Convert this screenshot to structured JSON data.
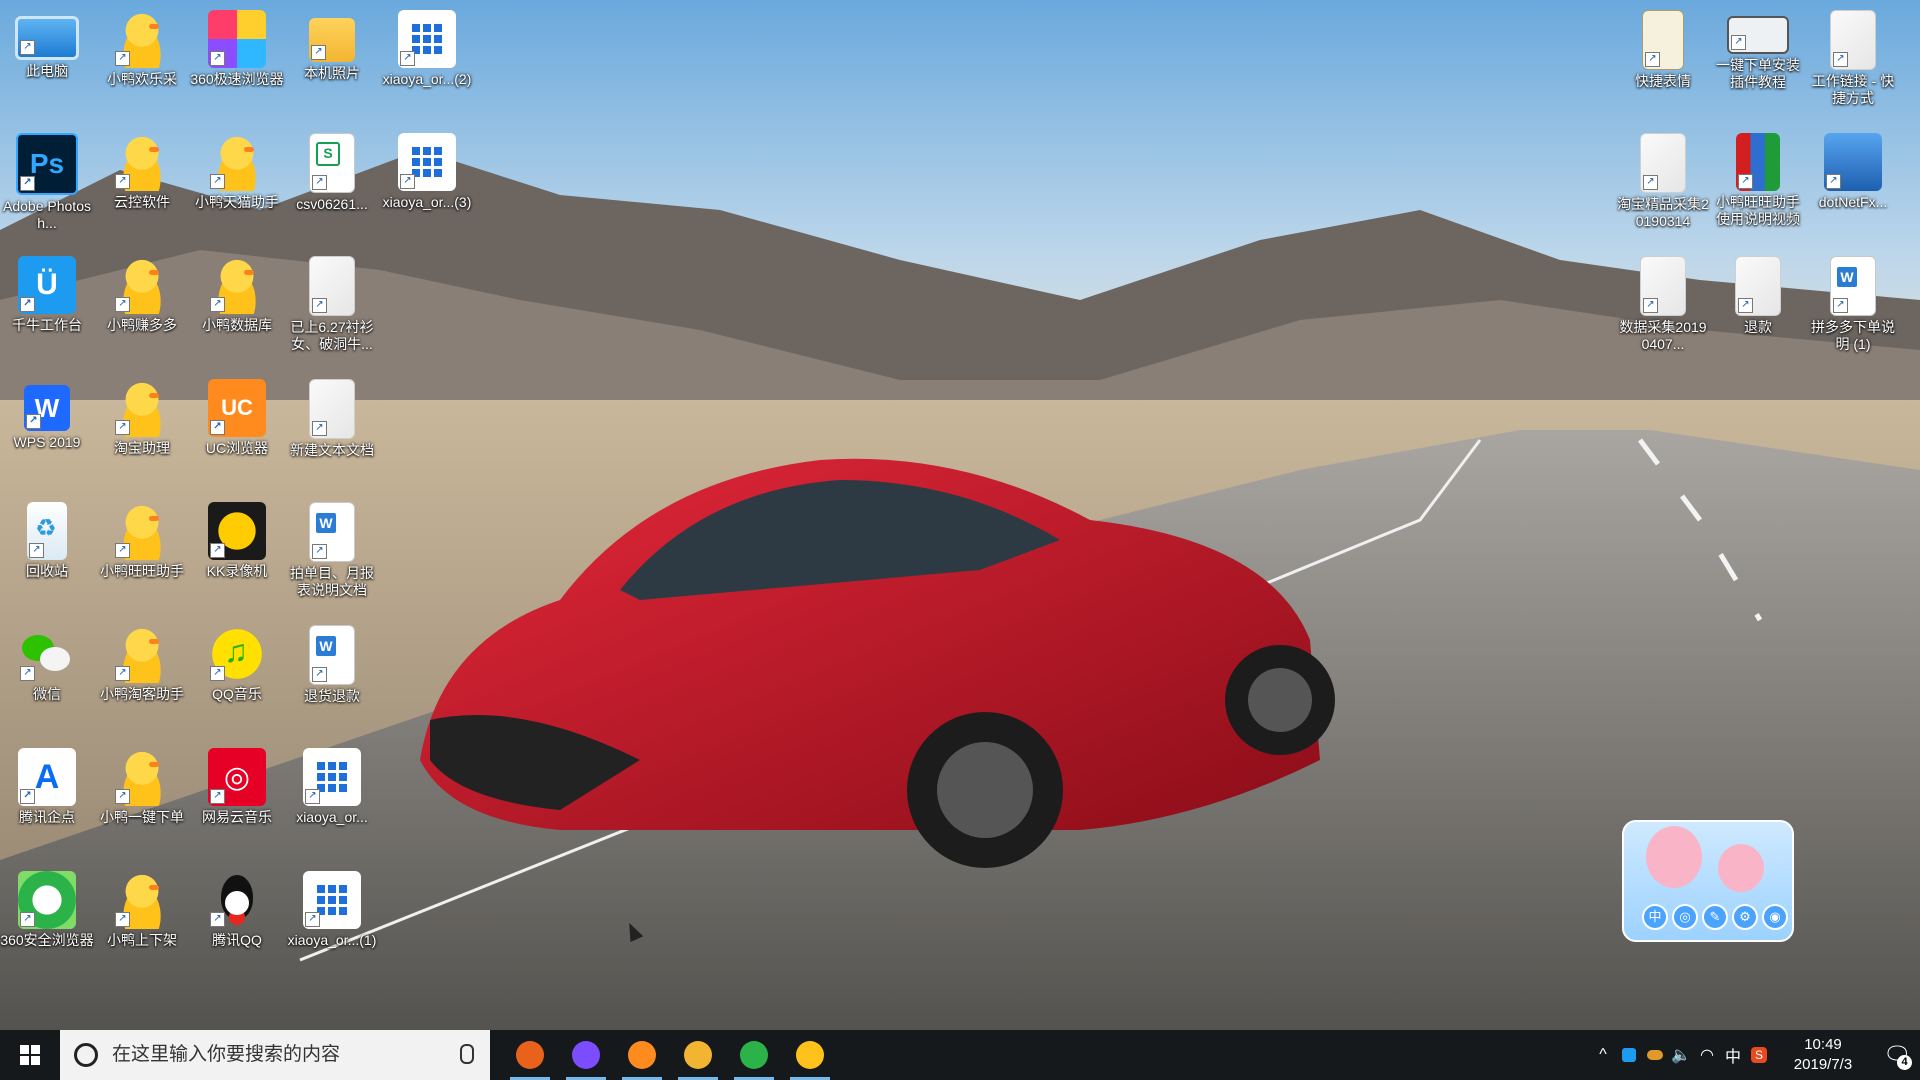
{
  "desktop": {
    "icons_left": [
      {
        "label": "此电脑",
        "icon": "computer-icon",
        "style": "pc"
      },
      {
        "label": "小鸭欢乐采",
        "icon": "duck-app-icon",
        "style": "duck"
      },
      {
        "label": "360极速浏览器",
        "icon": "browser-360-icon",
        "style": "browser360"
      },
      {
        "label": "本机照片",
        "icon": "folder-icon",
        "style": "folder"
      },
      {
        "label": "xiaoya_or...(2)",
        "icon": "app-grid-icon",
        "style": "winapp"
      },
      {
        "label": "Adobe Photosh...",
        "icon": "photoshop-icon",
        "style": "ps",
        "glyph": "Ps"
      },
      {
        "label": "云控软件",
        "icon": "duck-shield-icon",
        "style": "duck"
      },
      {
        "label": "小鸭天猫助手",
        "icon": "duck-tmall-icon",
        "style": "duck"
      },
      {
        "label": "csv06261...",
        "icon": "spreadsheet-file-icon",
        "style": "csv"
      },
      {
        "label": "xiaoya_or...(3)",
        "icon": "app-grid-icon",
        "style": "winapp"
      },
      {
        "label": "千牛工作台",
        "icon": "qianniu-icon",
        "style": "blueq",
        "glyph": "Ü"
      },
      {
        "label": "小鸭赚多多",
        "icon": "duck-app-icon",
        "style": "duck"
      },
      {
        "label": "小鸭数据库",
        "icon": "duck-database-icon",
        "style": "duck"
      },
      {
        "label": "已上6.27衬衫女、破洞牛...",
        "icon": "text-file-icon",
        "style": "doc"
      },
      {
        "label": "",
        "icon": "",
        "style": "none"
      },
      {
        "label": "WPS 2019",
        "icon": "wps-icon",
        "style": "wps",
        "glyph": "W"
      },
      {
        "label": "淘宝助理",
        "icon": "taobao-assistant-icon",
        "style": "duck"
      },
      {
        "label": "UC浏览器",
        "icon": "uc-browser-icon",
        "style": "uc",
        "glyph": "UC"
      },
      {
        "label": "新建文本文档",
        "icon": "text-file-icon",
        "style": "doc"
      },
      {
        "label": "",
        "icon": "",
        "style": "none"
      },
      {
        "label": "回收站",
        "icon": "recycle-bin-icon",
        "style": "recycle"
      },
      {
        "label": "小鸭旺旺助手",
        "icon": "duck-wangwang-icon",
        "style": "duck"
      },
      {
        "label": "KK录像机",
        "icon": "kk-recorder-icon",
        "style": "kk"
      },
      {
        "label": "拍单目、月报表说明文档",
        "icon": "word-file-icon",
        "style": "wordd"
      },
      {
        "label": "",
        "icon": "",
        "style": "none"
      },
      {
        "label": "微信",
        "icon": "wechat-icon",
        "style": "wechat"
      },
      {
        "label": "小鸭淘客助手",
        "icon": "duck-app-icon",
        "style": "duck"
      },
      {
        "label": "QQ音乐",
        "icon": "qq-music-icon",
        "style": "qqmusic"
      },
      {
        "label": "退货退款",
        "icon": "word-file-icon",
        "style": "wordd"
      },
      {
        "label": "",
        "icon": "",
        "style": "none"
      },
      {
        "label": "腾讯企点",
        "icon": "tencent-qidian-icon",
        "style": "tencent-pt",
        "glyph": "A"
      },
      {
        "label": "小鸭一键下单",
        "icon": "duck-app-icon",
        "style": "duck"
      },
      {
        "label": "网易云音乐",
        "icon": "netease-music-icon",
        "style": "netease",
        "glyph": "◎"
      },
      {
        "label": "xiaoya_or...",
        "icon": "app-grid-icon",
        "style": "winapp"
      },
      {
        "label": "",
        "icon": "",
        "style": "none"
      },
      {
        "label": "360安全浏览器",
        "icon": "browser-360-safe-icon",
        "style": "b360safe"
      },
      {
        "label": "小鸭上下架",
        "icon": "duck-app-icon",
        "style": "duck"
      },
      {
        "label": "腾讯QQ",
        "icon": "qq-icon",
        "style": "qq"
      },
      {
        "label": "xiaoya_or...(1)",
        "icon": "app-grid-icon",
        "style": "winapp"
      },
      {
        "label": "",
        "icon": "",
        "style": "none"
      }
    ],
    "icons_right": [
      {
        "label": "快捷表情",
        "icon": "notebook-icon",
        "style": "notebook"
      },
      {
        "label": "一键下单安装插件教程",
        "icon": "video-file-icon",
        "style": "screen"
      },
      {
        "label": "工作链接 - 快捷方式",
        "icon": "text-file-icon",
        "style": "doc"
      },
      {
        "label": "淘宝精品采集20190314",
        "icon": "text-file-icon",
        "style": "doc"
      },
      {
        "label": "小鸭旺旺助手使用说明视频",
        "icon": "winrar-archive-icon",
        "style": "winrar"
      },
      {
        "label": "dotNetFx...",
        "icon": "dotnet-installer-icon",
        "style": "dotnet"
      },
      {
        "label": "数据采集20190407...",
        "icon": "text-file-icon",
        "style": "doc"
      },
      {
        "label": "退款",
        "icon": "text-file-icon",
        "style": "doc"
      },
      {
        "label": "拼多多下单说明 (1)",
        "icon": "word-file-icon",
        "style": "wordd"
      }
    ]
  },
  "widget": {
    "buttons": [
      "中",
      "◎",
      "✎",
      "⚙",
      "◉"
    ]
  },
  "taskbar": {
    "search_placeholder": "在这里输入你要搜索的内容",
    "apps": [
      {
        "name": "taskbar-kk-recorder",
        "icon": "kk-recorder-icon",
        "color": "#e8621c"
      },
      {
        "name": "taskbar-360-browser",
        "icon": "browser-360-icon",
        "color": "#7c4dff"
      },
      {
        "name": "taskbar-uc-browser",
        "icon": "uc-browser-icon",
        "color": "#ff8b1f"
      },
      {
        "name": "taskbar-file-explorer",
        "icon": "folder-icon",
        "color": "#f2b531"
      },
      {
        "name": "taskbar-360-safe-browser",
        "icon": "browser-360-safe-icon",
        "color": "#2bb34a"
      },
      {
        "name": "taskbar-duck-app",
        "icon": "duck-app-icon",
        "color": "#ffc21a"
      }
    ],
    "tray": {
      "chevron": "^",
      "ime": "中",
      "time": "10:49",
      "date": "2019/7/3",
      "notification_count": "4"
    }
  }
}
